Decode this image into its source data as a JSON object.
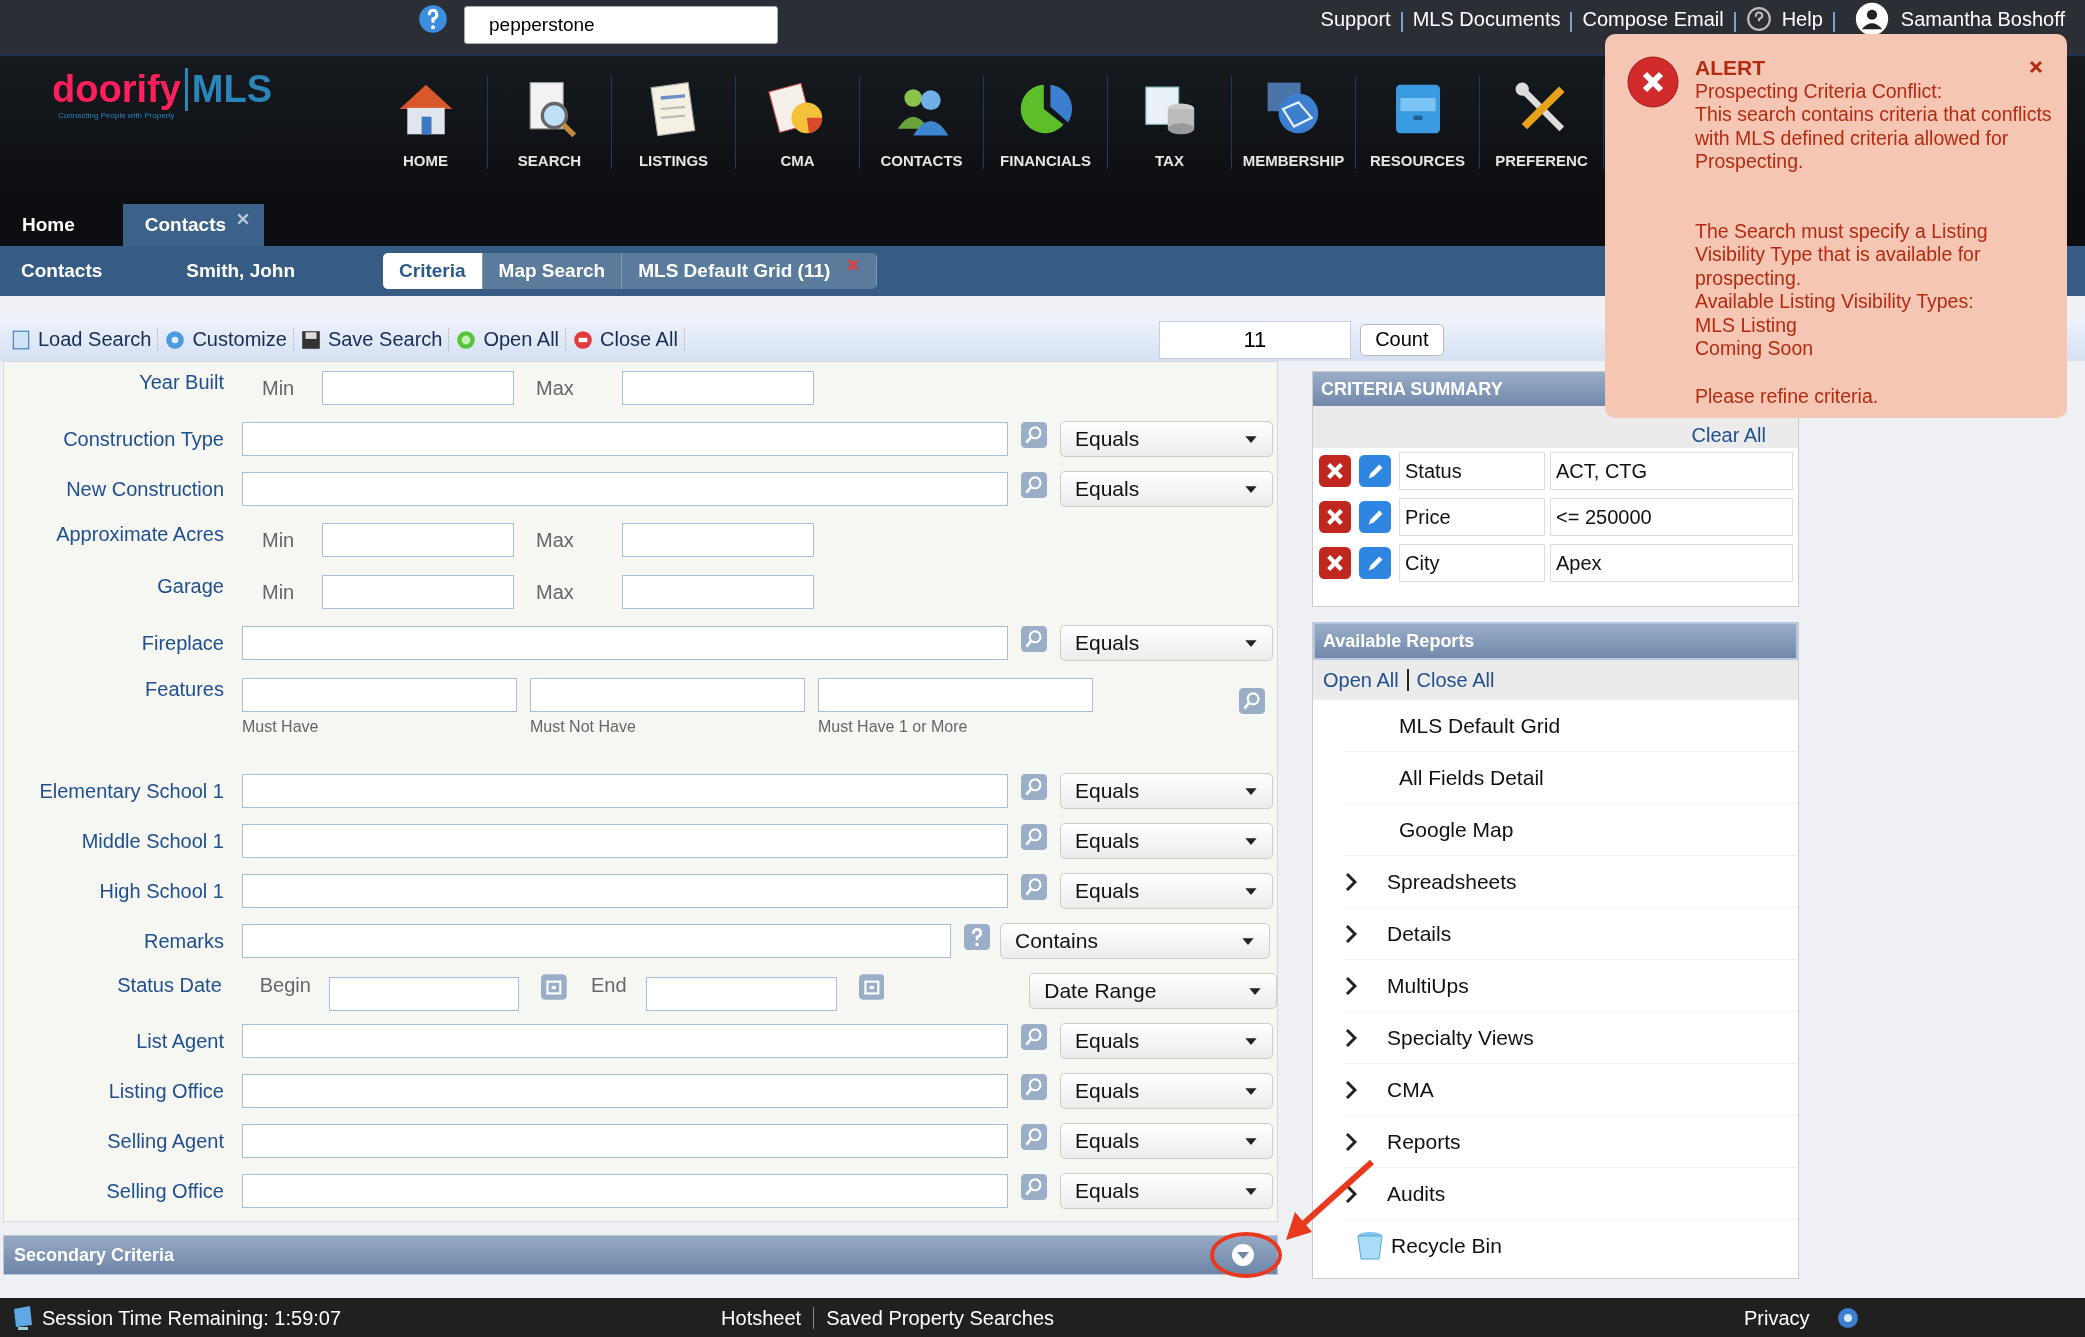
{
  "header": {
    "search_field": {
      "value": "pepperstone"
    },
    "logo": {
      "brand": "doorify",
      "suffix": "MLS",
      "tagline": "Connecting People with Property"
    },
    "top_links": [
      "Support",
      "MLS Documents",
      "Compose Email"
    ],
    "help_link": "Help",
    "user_name": "Samantha Boshoff",
    "nav": [
      {
        "label": "HOME"
      },
      {
        "label": "SEARCH"
      },
      {
        "label": "LISTINGS"
      },
      {
        "label": "CMA"
      },
      {
        "label": "CONTACTS"
      },
      {
        "label": "FINANCIALS"
      },
      {
        "label": "TAX"
      },
      {
        "label": "MEMBERSHIP"
      },
      {
        "label": "RESOURCES"
      },
      {
        "label": "PREFERENC"
      }
    ]
  },
  "page_tabs": [
    {
      "label": "Home",
      "selected": false,
      "closable": false
    },
    {
      "label": "Contacts",
      "selected": true,
      "closable": true
    }
  ],
  "breadcrumbs": [
    "Contacts",
    "Smith, John"
  ],
  "view_tabs": [
    {
      "label": "Criteria",
      "selected": true,
      "closable": false
    },
    {
      "label": "Map Search",
      "selected": false,
      "closable": false
    },
    {
      "label": "MLS Default Grid (11)",
      "selected": false,
      "closable": true
    }
  ],
  "toolbar": [
    {
      "label": "Load Search"
    },
    {
      "label": "Customize"
    },
    {
      "label": "Save Search"
    },
    {
      "label": "Open All"
    },
    {
      "label": "Close All"
    }
  ],
  "count": {
    "value": "11",
    "button": "Count"
  },
  "form_rows": [
    {
      "kind": "range",
      "label": "Year Built",
      "min_label": "Min",
      "max_label": "Max"
    },
    {
      "kind": "lookup",
      "label": "Construction Type",
      "operator": "Equals"
    },
    {
      "kind": "lookup",
      "label": "New Construction",
      "operator": "Equals"
    },
    {
      "kind": "range",
      "label": "Approximate Acres",
      "min_label": "Min",
      "max_label": "Max"
    },
    {
      "kind": "range",
      "label": "Garage",
      "min_label": "Min",
      "max_label": "Max"
    },
    {
      "kind": "lookup",
      "label": "Fireplace",
      "operator": "Equals"
    },
    {
      "kind": "features",
      "label": "Features",
      "sublabels": [
        "Must Have",
        "Must Not Have",
        "Must Have 1 or More"
      ]
    },
    {
      "kind": "lookup",
      "label": "Elementary School 1",
      "operator": "Equals"
    },
    {
      "kind": "lookup",
      "label": "Middle School 1",
      "operator": "Equals"
    },
    {
      "kind": "lookup",
      "label": "High School 1",
      "operator": "Equals"
    },
    {
      "kind": "remarks",
      "label": "Remarks",
      "operator": "Contains"
    },
    {
      "kind": "date",
      "label": "Status Date",
      "begin_label": "Begin",
      "end_label": "End",
      "operator": "Date Range"
    },
    {
      "kind": "lookup",
      "label": "List Agent",
      "operator": "Equals"
    },
    {
      "kind": "lookup",
      "label": "Listing Office",
      "operator": "Equals"
    },
    {
      "kind": "lookup",
      "label": "Selling Agent",
      "operator": "Equals"
    },
    {
      "kind": "lookup",
      "label": "Selling Office",
      "operator": "Equals"
    }
  ],
  "secondary_criteria": {
    "title": "Secondary Criteria",
    "expanded": false
  },
  "criteria_summary": {
    "title": "CRITERIA SUMMARY",
    "clear_all": "Clear All",
    "rows": [
      {
        "field": "Status",
        "value": "ACT, CTG"
      },
      {
        "field": "Price",
        "value": "<= 250000"
      },
      {
        "field": "City",
        "value": "Apex"
      }
    ]
  },
  "available_reports": {
    "title": "Available Reports",
    "open_all": "Open All",
    "close_all": "Close All",
    "items": [
      {
        "kind": "report",
        "label": "MLS Default Grid"
      },
      {
        "kind": "report",
        "label": "All Fields Detail"
      },
      {
        "kind": "report",
        "label": "Google Map"
      },
      {
        "kind": "folder",
        "label": "Spreadsheets"
      },
      {
        "kind": "folder",
        "label": "Details"
      },
      {
        "kind": "folder",
        "label": "MultiUps"
      },
      {
        "kind": "folder",
        "label": "Specialty Views"
      },
      {
        "kind": "folder",
        "label": "CMA"
      },
      {
        "kind": "folder",
        "label": "Reports"
      },
      {
        "kind": "folder",
        "label": "Audits"
      },
      {
        "kind": "bin",
        "label": "Recycle Bin"
      }
    ]
  },
  "alert": {
    "title": "ALERT",
    "message": [
      [
        "Prospecting Criteria Conflict:",
        "This search contains criteria that conflicts with MLS defined criteria allowed for Prospecting."
      ],
      [
        "The Search must specify a Listing Visibility Type that is available for prospecting.",
        "Available Listing Visibility Types:",
        "MLS Listing",
        "Coming Soon"
      ],
      [
        "Please refine criteria."
      ]
    ]
  },
  "footer": {
    "session": "Session Time Remaining: 1:59:07",
    "links": [
      "Hotsheet",
      "Saved Property Searches"
    ],
    "privacy": "Privacy"
  }
}
